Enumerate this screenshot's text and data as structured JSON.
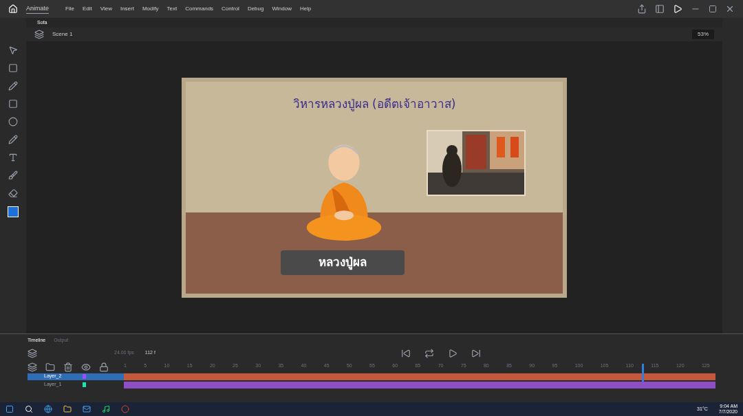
{
  "app": {
    "name": "Animate"
  },
  "menu": [
    "File",
    "Edit",
    "View",
    "Insert",
    "Modify",
    "Text",
    "Commands",
    "Control",
    "Debug",
    "Window",
    "Help"
  ],
  "doc_tabs": [
    {
      "label": "Sofa",
      "selected": true
    }
  ],
  "scene": {
    "label": "Scene 1",
    "zoom": "53%"
  },
  "stage": {
    "title": "วิหารหลวงปู่ผล (อดีตเจ้าอาวาส)",
    "caption": "หลวงปู่ผล"
  },
  "timeline": {
    "tabs": [
      {
        "label": "Timeline",
        "selected": true
      },
      {
        "label": "Output",
        "selected": false
      }
    ],
    "fps": "24.00 fps",
    "frame": "112 f",
    "playhead": {
      "level": 0.875
    },
    "ruler": [
      "1",
      "5",
      "10",
      "15",
      "20",
      "25",
      "30",
      "35",
      "40",
      "45",
      "50",
      "55",
      "60",
      "65",
      "70",
      "75",
      "80",
      "85",
      "90",
      "95",
      "100",
      "105",
      "110",
      "115",
      "120",
      "125"
    ],
    "layers": [
      {
        "name": "Layer_2",
        "selected": true,
        "color": "#9b4dff"
      },
      {
        "name": "Layer_1",
        "selected": false,
        "color": "#19e6b0"
      }
    ]
  },
  "taskbar": {
    "weather": "31°C",
    "time": "9:04 AM",
    "date": "7/7/2020"
  }
}
